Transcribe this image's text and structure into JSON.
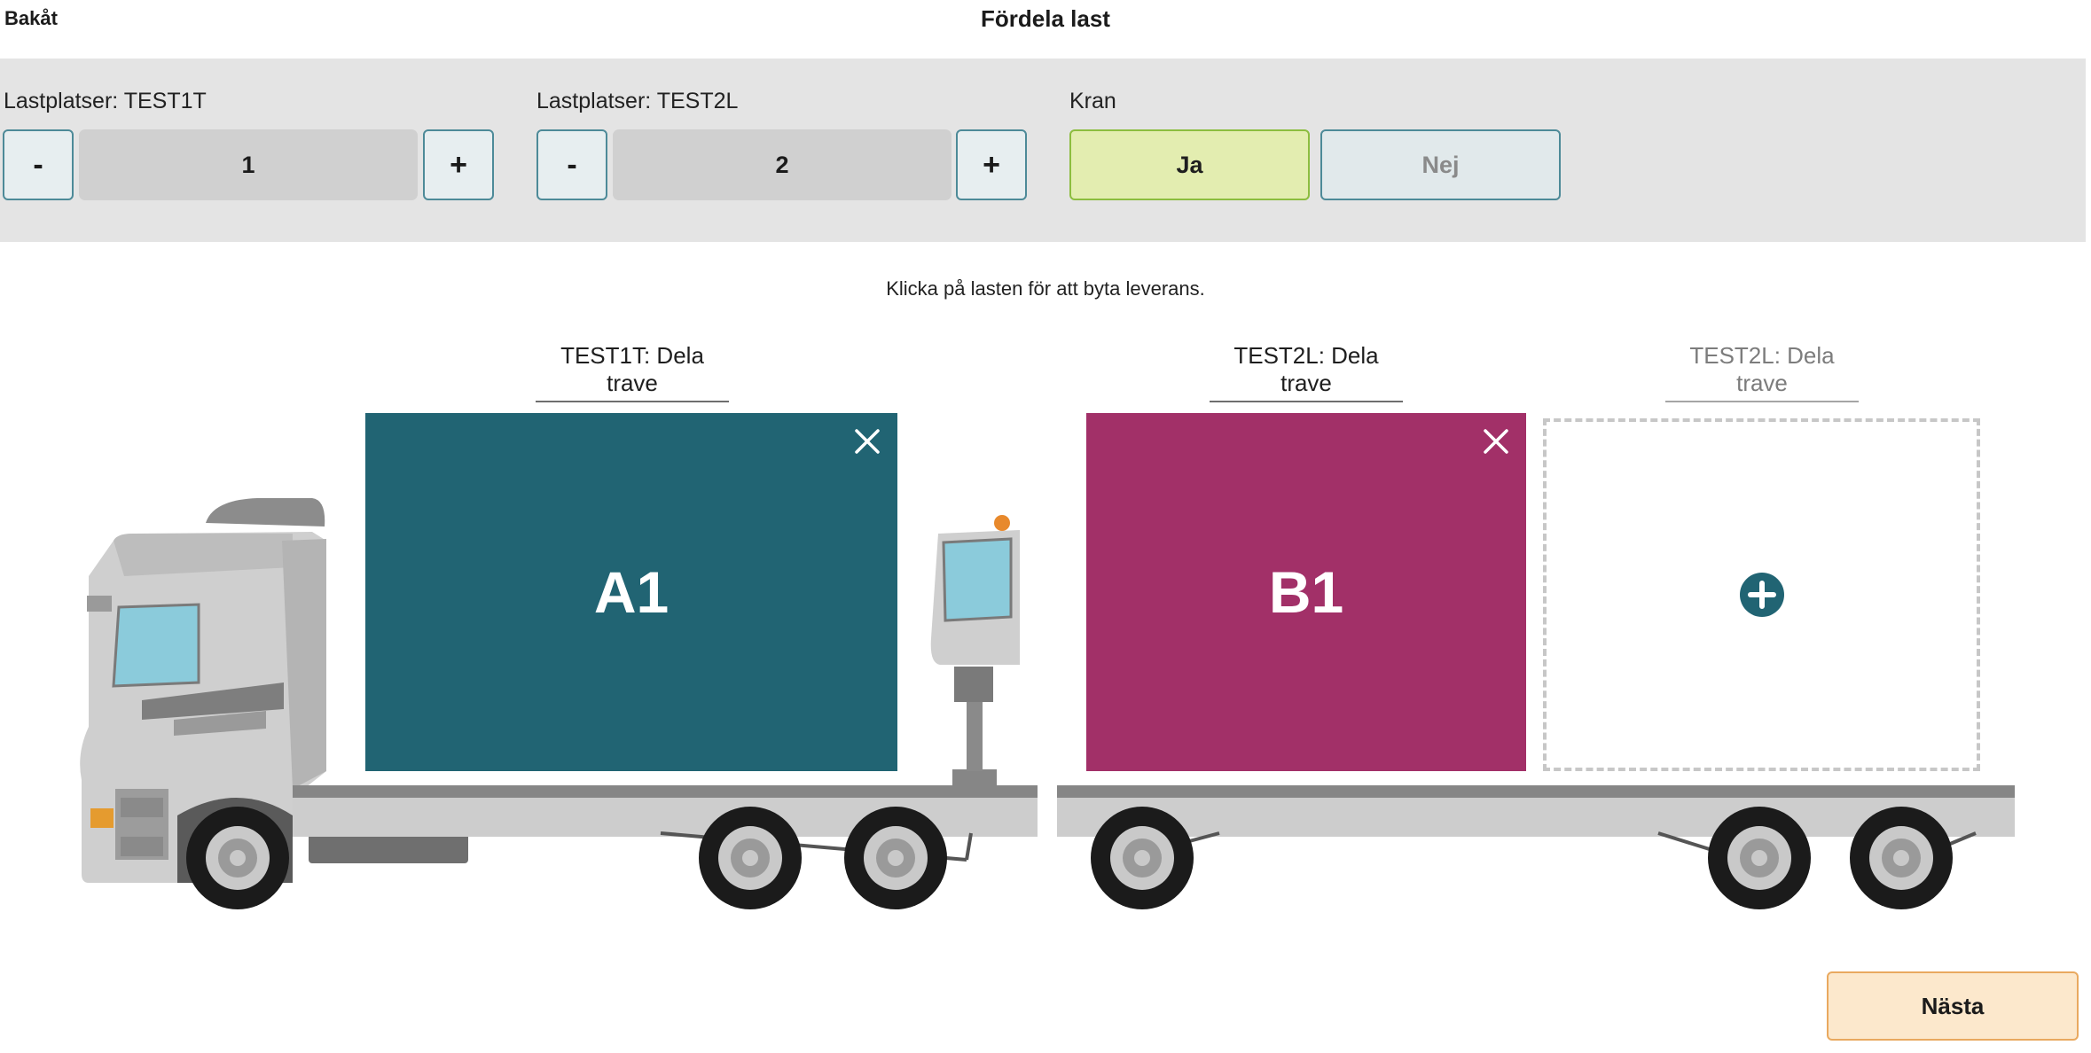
{
  "header": {
    "back_label": "Bakåt",
    "title": "Fördela last"
  },
  "controls": {
    "load_places_1": {
      "label": "Lastplatser: TEST1T",
      "minus": "-",
      "value": "1",
      "plus": "+"
    },
    "load_places_2": {
      "label": "Lastplatser: TEST2L",
      "minus": "-",
      "value": "2",
      "plus": "+"
    },
    "crane": {
      "label": "Kran",
      "yes": "Ja",
      "no": "Nej",
      "selected": "Ja"
    }
  },
  "instruction": "Klicka på lasten för att byta leverans.",
  "slots": [
    {
      "label": "TEST1T: Dela trave",
      "cargo": "A1",
      "color": "#216473"
    },
    {
      "label": "TEST2L: Dela trave",
      "cargo": "B1",
      "color": "#a23068"
    },
    {
      "label": "TEST2L: Dela trave",
      "cargo": "",
      "empty": true
    }
  ],
  "icons": {
    "remove": "close-icon",
    "add": "plus-circle-icon"
  },
  "colors": {
    "accent": "#216473",
    "cargo_b": "#a23068",
    "selected_toggle": "#e3edb0",
    "next_button": "#fce8cc"
  },
  "footer": {
    "next_label": "Nästa"
  }
}
